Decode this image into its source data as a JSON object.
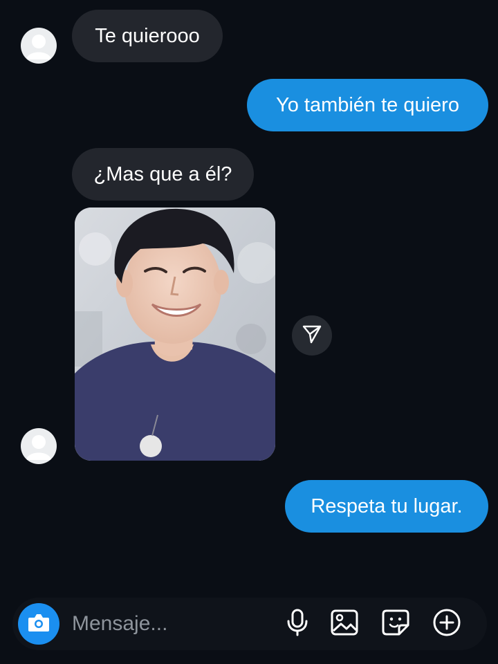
{
  "messages": [
    {
      "direction": "incoming",
      "text": "Te quierooo"
    },
    {
      "direction": "outgoing",
      "text": "Yo también te quiero"
    },
    {
      "direction": "incoming",
      "text": "¿Mas que a él?"
    },
    {
      "direction": "incoming",
      "type": "photo"
    },
    {
      "direction": "outgoing",
      "text": "Respeta tu lugar."
    }
  ],
  "composer": {
    "placeholder": "Mensaje..."
  },
  "icons": {
    "camera": "camera-icon",
    "microphone": "microphone-icon",
    "gallery": "image-icon",
    "sticker": "sticker-icon",
    "add": "plus-circle-icon",
    "share": "paper-plane-icon"
  },
  "colors": {
    "background": "#0a0e15",
    "incoming_bubble": "#23262d",
    "outgoing_bubble": "#1a8fe0",
    "camera_button": "#1b8ff0"
  }
}
